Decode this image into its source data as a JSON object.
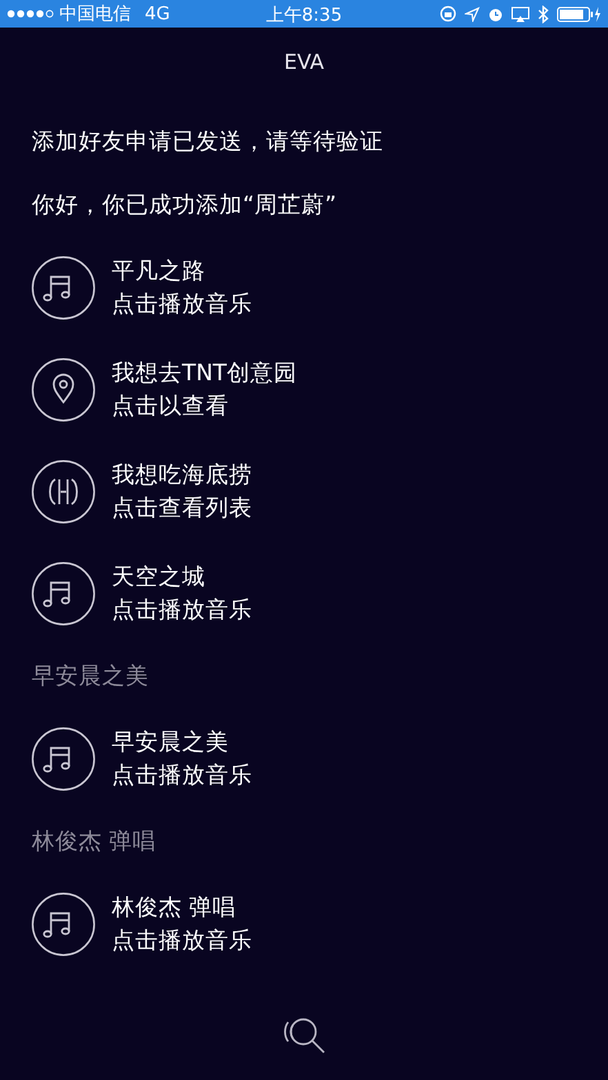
{
  "status_bar": {
    "carrier": "中国电信",
    "network": "4G",
    "time": "上午8:35"
  },
  "title": "EVA",
  "messages": [
    {
      "kind": "text",
      "text": "添加好友申请已发送，请等待验证"
    },
    {
      "kind": "text",
      "text": "你好，你已成功添加“周芷蔚”"
    },
    {
      "kind": "music",
      "title": "平凡之路",
      "action": "点击播放音乐"
    },
    {
      "kind": "location",
      "title": "我想去TNT创意园",
      "action": "点击以查看"
    },
    {
      "kind": "restaurant",
      "title": "我想吃海底捞",
      "action": "点击查看列表"
    },
    {
      "kind": "music",
      "title": "天空之城",
      "action": "点击播放音乐"
    },
    {
      "kind": "prompt",
      "text": "早安晨之美"
    },
    {
      "kind": "music",
      "title": "早安晨之美",
      "action": "点击播放音乐"
    },
    {
      "kind": "prompt",
      "text": "林俊杰 弹唱"
    },
    {
      "kind": "music",
      "title": "林俊杰 弹唱",
      "action": "点击播放音乐"
    }
  ]
}
